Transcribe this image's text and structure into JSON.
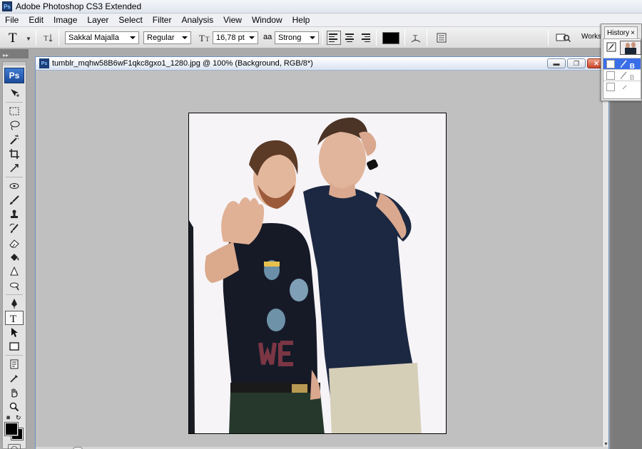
{
  "app": {
    "title": "Adobe Photoshop CS3 Extended",
    "logo_text": "Ps"
  },
  "menu": [
    "File",
    "Edit",
    "Image",
    "Layer",
    "Select",
    "Filter",
    "Analysis",
    "View",
    "Window",
    "Help"
  ],
  "options_bar": {
    "tool_icon": "T",
    "font_family": "Sakkal Majalla",
    "font_style": "Regular",
    "font_size": "16,78 pt",
    "aa_label": "aa",
    "antialias": "Strong",
    "text_color": "#000000",
    "workspace_label": "Works"
  },
  "document": {
    "title": "tumblr_mqhw58B6wF1qkc8gxo1_1280.jpg @ 100% (Background, RGB/8*)",
    "canvas_color": "#c0c0c0"
  },
  "history": {
    "tab_label": "History",
    "close_glyph": "×",
    "rows": [
      {
        "label": "B",
        "selected": true
      },
      {
        "label": "B",
        "selected": false
      },
      {
        "label": "",
        "selected": false
      }
    ]
  },
  "tools": [
    "move-icon",
    "marquee-icon",
    "lasso-icon",
    "magic-wand-icon",
    "crop-icon",
    "slice-icon",
    "healing-icon",
    "brush-icon",
    "clone-stamp-icon",
    "history-brush-icon",
    "eraser-icon",
    "paint-bucket-icon",
    "blur-icon",
    "dodge-icon",
    "pen-icon",
    "type-icon",
    "path-select-icon",
    "shape-icon",
    "notes-icon",
    "eyedropper-icon",
    "hand-icon",
    "zoom-icon"
  ],
  "colors": {
    "foreground": "#000000",
    "background": "#000000",
    "accent": "#3a6ee8"
  }
}
